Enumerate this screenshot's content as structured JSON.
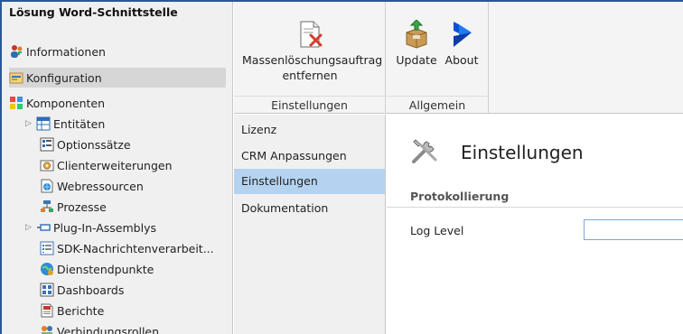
{
  "left_pane": {
    "title": "Lösung Word-Schnittstelle",
    "items": [
      {
        "label": "Informationen",
        "icon": "info-people-icon",
        "level": 0
      },
      {
        "label": "Konfiguration",
        "icon": "configuration-icon",
        "level": 0,
        "selected": true
      },
      {
        "label": "Komponenten",
        "icon": "components-icon",
        "level": 0
      },
      {
        "label": "Entitäten",
        "icon": "entities-icon",
        "level": 1,
        "expandable": true
      },
      {
        "label": "Optionssätze",
        "icon": "optionsets-icon",
        "level": 1
      },
      {
        "label": "Clienterweiterungen",
        "icon": "client-extensions-icon",
        "level": 1
      },
      {
        "label": "Webressourcen",
        "icon": "web-resources-icon",
        "level": 1
      },
      {
        "label": "Prozesse",
        "icon": "processes-icon",
        "level": 1
      },
      {
        "label": "Plug-In-Assemblys",
        "icon": "plugin-assemblies-icon",
        "level": 1,
        "expandable": true
      },
      {
        "label": "SDK-Nachrichtenverarbeit...",
        "icon": "sdk-messages-icon",
        "level": 1
      },
      {
        "label": "Dienstendpunkte",
        "icon": "service-endpoints-icon",
        "level": 1
      },
      {
        "label": "Dashboards",
        "icon": "dashboards-icon",
        "level": 1
      },
      {
        "label": "Berichte",
        "icon": "reports-icon",
        "level": 1
      },
      {
        "label": "Verbindungsrollen",
        "icon": "connection-roles-icon",
        "level": 1
      }
    ]
  },
  "ribbon": {
    "groups": [
      {
        "label": "Einstellungen",
        "buttons": [
          {
            "label": "Massenlöschungsauftrag entfernen",
            "icon": "delete-document-icon"
          }
        ]
      },
      {
        "label": "Allgemein",
        "buttons": [
          {
            "label": "Update",
            "icon": "update-package-icon"
          },
          {
            "label": "About",
            "icon": "dynamics-logo-icon"
          }
        ]
      }
    ]
  },
  "subnav": {
    "items": [
      {
        "label": "Lizenz"
      },
      {
        "label": "CRM Anpassungen"
      },
      {
        "label": "Einstellungen",
        "selected": true
      },
      {
        "label": "Dokumentation"
      }
    ]
  },
  "content": {
    "title": "Einstellungen",
    "title_icon": "tools-icon",
    "section": "Protokollierung",
    "fields": [
      {
        "label": "Log Level",
        "value": ""
      }
    ]
  },
  "colors": {
    "frame": "#2b5797",
    "selected_nav": "#d6d6d6",
    "selected_subnav": "#b5d3f0",
    "input_border": "#7aa7d6"
  }
}
